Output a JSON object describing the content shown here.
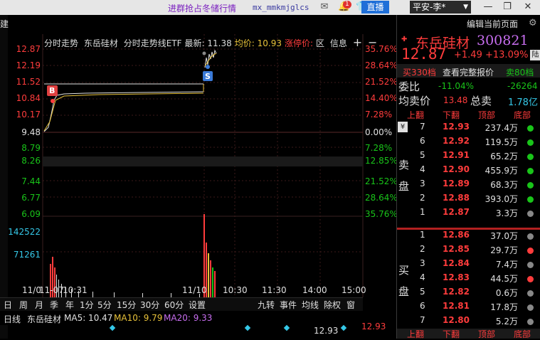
{
  "titlebar": {
    "promo": "进群抢占冬储行情",
    "user": "mx_mmkmjglcs",
    "notify_count": "1",
    "live_label": "直播",
    "account_label": "平安-李*"
  },
  "left_strip": {
    "label": "建"
  },
  "chart_header": {
    "title": "分时走势",
    "name": "东岳硅材",
    "etf_label": "分时走势线ETF",
    "latest_label": "最新:",
    "latest": "11.38",
    "avg_label": "均价:",
    "avg": "10.93",
    "limit_label": "涨停价:",
    "interval_label": "区",
    "info_label": "信息"
  },
  "axes": {
    "price_left": [
      "12.87",
      "12.19",
      "11.52",
      "10.84",
      "10.17",
      "9.48",
      "8.79",
      "8.26",
      "7.44",
      "6.77",
      "6.09"
    ],
    "pct_right": [
      "35.76%",
      "28.64%",
      "21.52%",
      "14.40%",
      "7.28%",
      "0.00%",
      "7.28%",
      "12.85%",
      "21.52%",
      "28.64%",
      "35.76%"
    ],
    "volume_left": [
      "142522",
      "71261"
    ],
    "time_labels": [
      "11/0",
      "11-07",
      "10:31",
      "11/10",
      "10:30",
      "11:30",
      "14:00",
      "15:00"
    ]
  },
  "markers": {
    "buy": "B",
    "sell": "S"
  },
  "period_bar": [
    "日",
    "周",
    "月",
    "季",
    "年",
    "1分",
    "5分",
    "15分",
    "30分",
    "60分",
    "设置"
  ],
  "period_bar_right": [
    "九转",
    "事件",
    "均线",
    "除权",
    "窗"
  ],
  "ma_bar": {
    "label": "日线",
    "name": "东岳硅材",
    "ma5": "MA5: 10.47",
    "ma10": "MA10: 9.79",
    "ma20": "MA20: 9.33",
    "last_price": "12.93",
    "right_price": "12.93"
  },
  "right_panel": {
    "edit_label": "编辑当前页面",
    "stock_name": "东岳硅材",
    "stock_code": "300821",
    "price": "12.87",
    "change": "+1.49",
    "change_pct": "+13.09%",
    "market_tag": "陆",
    "sell_depth": "买330档",
    "full_quote": "查看完整报价",
    "buy_depth": "卖80档",
    "wei_label": "委比",
    "wei_value": "-11.04%",
    "wei_diff": "-26264",
    "avg_label": "均卖价",
    "avg_value": "13.48",
    "total_label": "总卖",
    "total_value": "1.78亿",
    "col_headers": [
      "上翻",
      "下翻",
      "顶部",
      "底部"
    ],
    "sell_side_label": "卖盘",
    "buy_side_label": "买盘",
    "asks": [
      {
        "idx": "7",
        "price": "12.93",
        "vol": "237.4万",
        "dot": "#19c419"
      },
      {
        "idx": "6",
        "price": "12.92",
        "vol": "119.5万",
        "dot": "#19c419"
      },
      {
        "idx": "5",
        "price": "12.91",
        "vol": "65.2万",
        "dot": "#19c419"
      },
      {
        "idx": "4",
        "price": "12.90",
        "vol": "455.9万",
        "dot": "#19c419"
      },
      {
        "idx": "3",
        "price": "12.89",
        "vol": "68.3万",
        "dot": "#19c419"
      },
      {
        "idx": "2",
        "price": "12.88",
        "vol": "393.0万",
        "dot": "#19c419"
      },
      {
        "idx": "1",
        "price": "12.87",
        "vol": "3.3万",
        "dot": "#888888"
      }
    ],
    "bids": [
      {
        "idx": "1",
        "price": "12.86",
        "vol": "37.0万",
        "dot": "#888888"
      },
      {
        "idx": "2",
        "price": "12.85",
        "vol": "29.7万",
        "dot": "#ff3c3c"
      },
      {
        "idx": "3",
        "price": "12.84",
        "vol": "7.4万",
        "dot": "#888888"
      },
      {
        "idx": "4",
        "price": "12.83",
        "vol": "44.5万",
        "dot": "#ff3c3c"
      },
      {
        "idx": "5",
        "price": "12.82",
        "vol": "0.6万",
        "dot": "#888888"
      },
      {
        "idx": "6",
        "price": "12.81",
        "vol": "17.8万",
        "dot": "#888888"
      },
      {
        "idx": "7",
        "price": "12.80",
        "vol": "5.2万",
        "dot": "#888888"
      }
    ]
  }
}
